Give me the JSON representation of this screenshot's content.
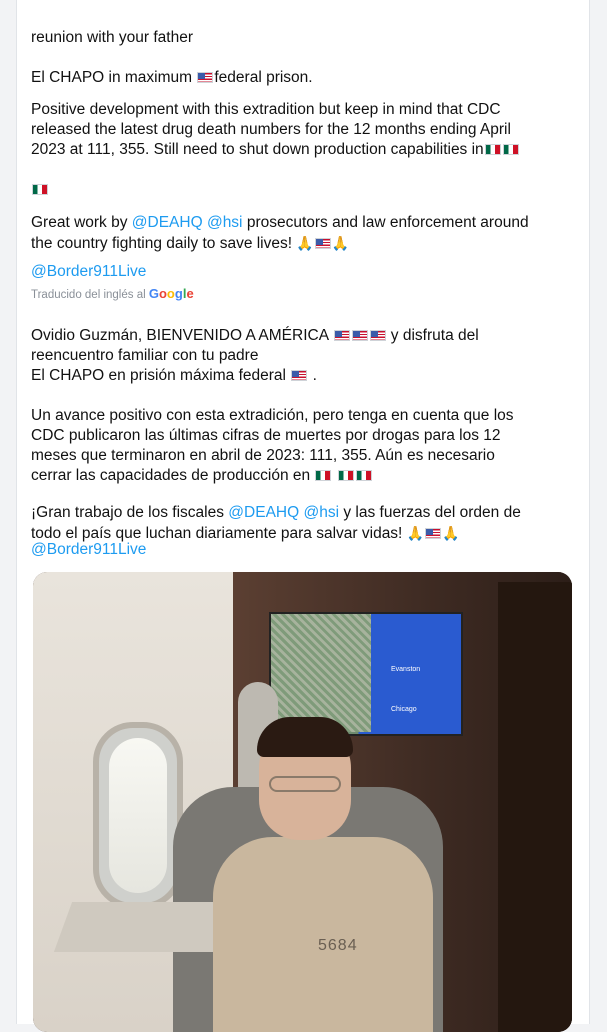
{
  "tweet_en": {
    "line1": "reunion with your father",
    "line2a": "El CHAPO in maximum ",
    "line2b": "federal prison.",
    "para2": "Positive development with this extradition but keep in mind that CDC\nreleased the latest drug death numbers for the 12 months ending April\n2023 at 111, 355. Still need to shut down production capabilities in",
    "para3_a": "Great work by ",
    "para3_m1": "@DEAHQ",
    "para3_m2": "@hsi",
    "para3_b": " prosecutors and law enforcement around\nthe country fighting daily to save lives! ",
    "handle": "@Border911Live"
  },
  "translation": {
    "label": "Traducido del inglés al",
    "google_g1": "G",
    "google_g2": "o",
    "google_g3": "o",
    "google_g4": "g",
    "google_g5": "l",
    "google_g6": "e",
    "para1a": "Ovidio Guzmán, BIENVENIDO A AMÉRICA ",
    "para1b": " y disfruta del\nreencuentro familiar con tu padre\nEl CHAPO en prisión máxima federal ",
    "para1c": " .",
    "para2": "Un avance positivo con esta extradición, pero tenga en cuenta que los\nCDC publicaron las últimas cifras de muertes por drogas para los 12\nmeses que terminaron en abril de 2023: 111, 355. Aún es necesario\ncerrar las capacidades de producción en ",
    "para3_a": "¡Gran trabajo de los fiscales ",
    "para3_m1": "@DEAHQ",
    "para3_m2": "@hsi",
    "para3_b": " y las fuerzas del orden de\ntodo el país que luchan diariamente para salvar vidas! ",
    "handle": "@Border911Live"
  },
  "photo": {
    "map_label1": "Evanston",
    "map_label2": "Chicago",
    "shirt_number": "5684"
  },
  "icons": {
    "us_flag": "us-flag-icon",
    "mx_flag": "mexico-flag-icon",
    "pray": "folded-hands-emoji"
  }
}
